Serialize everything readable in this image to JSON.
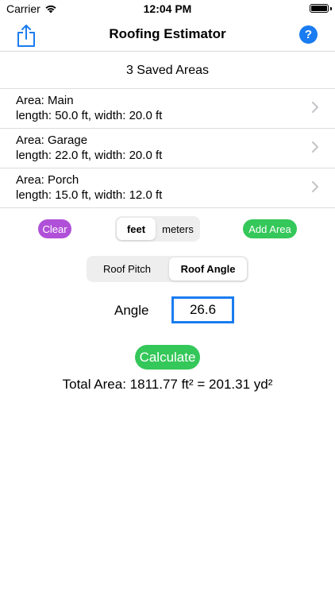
{
  "status_bar": {
    "carrier": "Carrier",
    "time": "12:04 PM"
  },
  "nav": {
    "title": "Roofing Estimator",
    "help_label": "?"
  },
  "saved_areas_title": "3 Saved Areas",
  "areas": [
    {
      "name": "Area: Main",
      "dims": "length: 50.0 ft, width: 20.0 ft"
    },
    {
      "name": "Area: Garage",
      "dims": "length: 22.0 ft, width: 20.0 ft"
    },
    {
      "name": "Area: Porch",
      "dims": "length: 15.0 ft, width: 12.0 ft"
    }
  ],
  "controls": {
    "clear_label": "Clear",
    "units": [
      "feet",
      "meters"
    ],
    "selected_unit": "feet",
    "add_label": "Add Area"
  },
  "roof_mode": {
    "options": [
      "Roof Pitch",
      "Roof Angle"
    ],
    "selected": "Roof Angle"
  },
  "angle": {
    "label": "Angle",
    "value": "26.6"
  },
  "calculate_label": "Calculate",
  "total_text": "Total Area: 1811.77 ft² = 201.31 yd²",
  "colors": {
    "accent_blue": "#1a7cf0",
    "clear_purple": "#b050d8",
    "green": "#34c759"
  }
}
